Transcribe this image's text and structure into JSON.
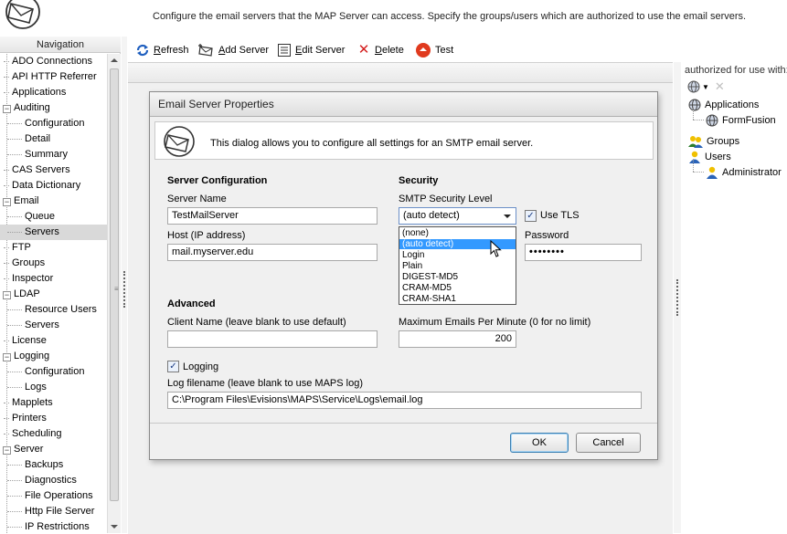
{
  "header": {
    "text": "Configure the email servers that the MAP Server can access.  Specify the groups/users which are authorized to use the email servers."
  },
  "nav": {
    "title": "Navigation",
    "items": [
      {
        "label": "ADO Connections",
        "level": 0
      },
      {
        "label": "API HTTP Referrer",
        "level": 0
      },
      {
        "label": "Applications",
        "level": 0
      },
      {
        "label": "Auditing",
        "level": 0,
        "expanded": true
      },
      {
        "label": "Configuration",
        "level": 1
      },
      {
        "label": "Detail",
        "level": 1
      },
      {
        "label": "Summary",
        "level": 1
      },
      {
        "label": "CAS Servers",
        "level": 0
      },
      {
        "label": "Data Dictionary",
        "level": 0
      },
      {
        "label": "Email",
        "level": 0,
        "expanded": true
      },
      {
        "label": "Queue",
        "level": 1
      },
      {
        "label": "Servers",
        "level": 1,
        "selected": true
      },
      {
        "label": "FTP",
        "level": 0
      },
      {
        "label": "Groups",
        "level": 0
      },
      {
        "label": "Inspector",
        "level": 0
      },
      {
        "label": "LDAP",
        "level": 0,
        "expanded": true
      },
      {
        "label": "Resource Users",
        "level": 1
      },
      {
        "label": "Servers",
        "level": 1
      },
      {
        "label": "License",
        "level": 0
      },
      {
        "label": "Logging",
        "level": 0,
        "expanded": true
      },
      {
        "label": "Configuration",
        "level": 1
      },
      {
        "label": "Logs",
        "level": 1
      },
      {
        "label": "Mapplets",
        "level": 0
      },
      {
        "label": "Printers",
        "level": 0
      },
      {
        "label": "Scheduling",
        "level": 0
      },
      {
        "label": "Server",
        "level": 0,
        "expanded": true
      },
      {
        "label": "Backups",
        "level": 1
      },
      {
        "label": "Diagnostics",
        "level": 1
      },
      {
        "label": "File Operations",
        "level": 1
      },
      {
        "label": "Http File Server",
        "level": 1
      },
      {
        "label": "IP Restrictions",
        "level": 1
      }
    ]
  },
  "toolbar": {
    "refresh": {
      "pre": "",
      "key": "R",
      "post": "efresh"
    },
    "add": {
      "pre": "",
      "key": "A",
      "post": "dd Server"
    },
    "edit": {
      "pre": "",
      "key": "E",
      "post": "dit Server"
    },
    "delete": {
      "pre": "",
      "key": "D",
      "post": "elete"
    },
    "test": {
      "pre": "",
      "key": "",
      "post": "Test"
    }
  },
  "right_panel": {
    "title": "authorized for use with:",
    "tree": [
      {
        "label": "Applications",
        "icon": "globe-icon",
        "level": 0
      },
      {
        "label": "FormFusion",
        "icon": "globe-icon",
        "level": 1
      },
      {
        "label": "Groups",
        "icon": "group-icon",
        "level": 0
      },
      {
        "label": "Users",
        "icon": "user-icon",
        "level": 0
      },
      {
        "label": "Administrator",
        "icon": "user-icon",
        "level": 1
      }
    ]
  },
  "dialog": {
    "title": "Email Server Properties",
    "banner": "This dialog allows you to configure all settings for an SMTP email server.",
    "server_config": {
      "heading": "Server Configuration",
      "server_name_label": "Server Name",
      "server_name_value": "TestMailServer",
      "host_label": "Host (IP address)",
      "host_value": "mail.myserver.edu"
    },
    "security": {
      "heading": "Security",
      "level_label": "SMTP Security Level",
      "level_value": "(auto detect)",
      "use_tls_label": "Use TLS",
      "use_tls_checked": true,
      "password_label": "Password",
      "password_value": "••••••••",
      "options": [
        "(none)",
        "(auto detect)",
        "Login",
        "Plain",
        "DIGEST-MD5",
        "CRAM-MD5",
        "CRAM-SHA1"
      ],
      "highlighted_option": "(auto detect)"
    },
    "advanced": {
      "heading": "Advanced",
      "client_name_label": "Client Name (leave blank to use default)",
      "client_name_value": "",
      "max_emails_label": "Maximum Emails Per Minute (0 for no limit)",
      "max_emails_value": "200",
      "logging_label": "Logging",
      "logging_checked": true,
      "log_filename_label": "Log filename (leave blank to use MAPS log)",
      "log_filename_value": "C:\\Program Files\\Evisions\\MAPS\\Service\\Logs\\email.log"
    },
    "ok_label": "OK",
    "cancel_label": "Cancel"
  },
  "colors": {
    "selection_highlight": "#3399ff",
    "nav_selected": "#d9d9d9",
    "delete_red": "#d42020",
    "test_red": "#e03a1e"
  }
}
